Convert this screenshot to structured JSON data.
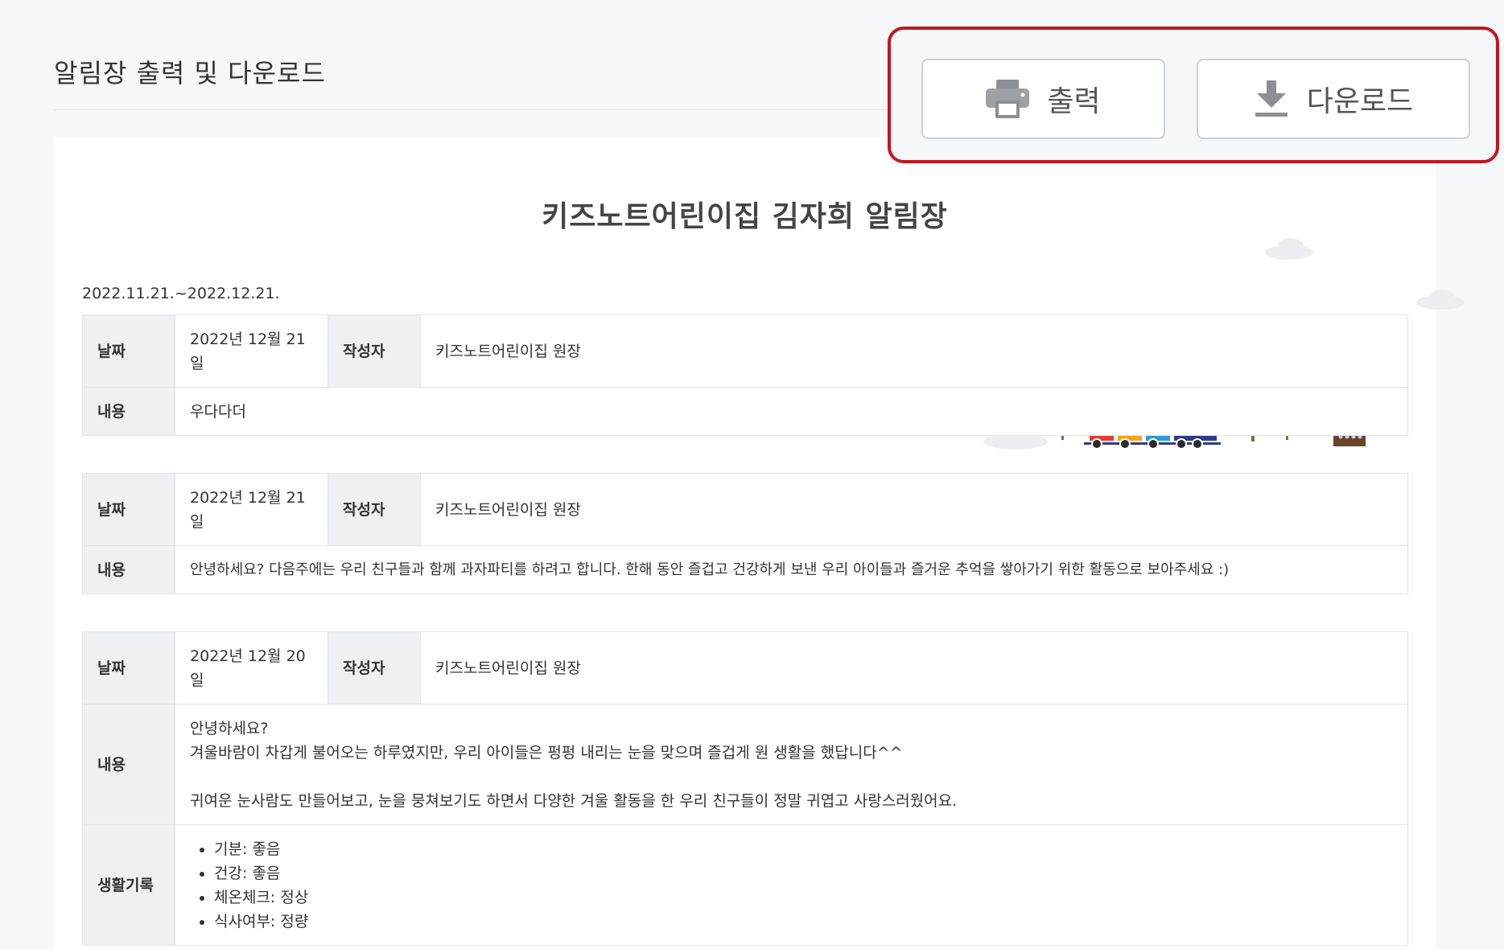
{
  "header": {
    "title": "알림장 출력 및 다운로드"
  },
  "actions": {
    "print_label": "출력",
    "download_label": "다운로드"
  },
  "document": {
    "title": "키즈노트어린이집 김자희 알림장",
    "period": "2022.11.21.~2022.12.21.",
    "labels": {
      "date": "날짜",
      "author": "작성자",
      "content": "내용",
      "life_record": "생활기록"
    },
    "entries": [
      {
        "date_line1": "2022년 12월 21",
        "date_line2": "일",
        "author": "키즈노트어린이집 원장",
        "content": "우다다더"
      },
      {
        "date_line1": "2022년 12월 21",
        "date_line2": "일",
        "author": "키즈노트어린이집 원장",
        "content": "안녕하세요?  다음주에는 우리 친구들과 함께 과자파티를 하려고 합니다. 한해 동안 즐겁고 건강하게 보낸 우리 아이들과 즐거운 추억을 쌓아가기 위한 활동으로 보아주세요 :)"
      },
      {
        "date_line1": "2022년 12월 20",
        "date_line2": "일",
        "author": "키즈노트어린이집 원장",
        "content_lines": [
          "안녕하세요?",
          "겨울바람이 차갑게 불어오는 하루였지만, 우리 아이들은 펑펑 내리는 눈을 맞으며 즐겁게 원 생활을 했답니다^^",
          "귀여운 눈사람도 만들어보고, 눈을 뭉쳐보기도 하면서 다양한 겨울 활동을 한 우리 친구들이 정말 귀엽고 사랑스러웠어요."
        ],
        "life_record": [
          "기분: 좋음",
          "건강: 좋음",
          "체온체크: 정상",
          "식사여부: 정량"
        ]
      }
    ]
  },
  "icons": {
    "print": "printer-icon",
    "download": "download-icon"
  },
  "colors": {
    "highlight_border": "#c3161f",
    "balloon_blue": "#1e7fce",
    "tree_green": "#13a150"
  }
}
